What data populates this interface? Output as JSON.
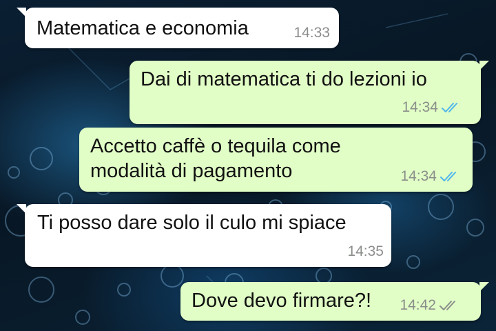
{
  "chat": {
    "messages": [
      {
        "direction": "incoming",
        "text": "Matematica e economia",
        "time": "14:33"
      },
      {
        "direction": "outgoing",
        "text": "Dai di matematica ti do lezioni io",
        "time": "14:34",
        "status": "read"
      },
      {
        "direction": "outgoing",
        "text": "Accetto caffè o tequila come\nmodalità di pagamento",
        "time": "14:34",
        "status": "read"
      },
      {
        "direction": "incoming",
        "text": "Ti posso dare solo il culo mi spiace",
        "time": "14:35"
      },
      {
        "direction": "outgoing",
        "text": "Dove devo firmare?!",
        "time": "14:42",
        "status": "delivered"
      }
    ]
  },
  "colors": {
    "incoming_bubble": "#ffffff",
    "outgoing_bubble": "#e1fec6",
    "read_tick": "#4fb6ec",
    "delivered_tick": "#8a8e8a"
  },
  "icons": {
    "status_read": "double-check-icon-blue",
    "status_delivered": "double-check-icon-gray"
  }
}
